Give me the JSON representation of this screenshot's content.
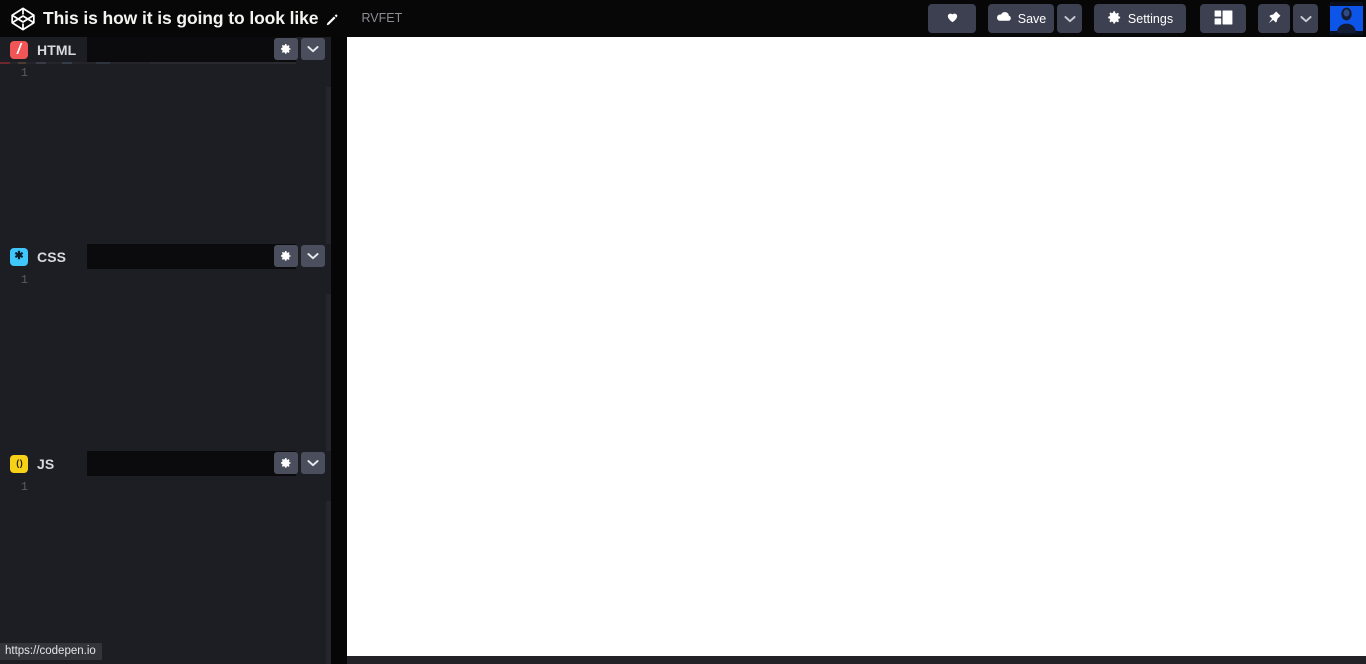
{
  "header": {
    "logo_icon": "codepen-logo-icon",
    "pen_title": "This is how it is going to look like",
    "title_edit_icon": "pencil-edit-icon",
    "author": "RVFET",
    "actions": {
      "heart_icon": "heart-icon",
      "heart_label": "",
      "save_icon": "cloud-icon",
      "save_label": "Save",
      "save_dropdown_icon": "chevron-down-icon",
      "settings_icon": "gear-icon",
      "settings_label": "Settings",
      "layout_icon": "layout-panels-icon",
      "pin_icon": "pin-icon",
      "pin_dropdown_icon": "chevron-down-icon",
      "avatar_alt": "user-avatar"
    }
  },
  "editors": [
    {
      "id": "html",
      "label": "HTML",
      "icon_glyph": "/",
      "icon_color": "#f25555",
      "icon_text_color": "#ffffff",
      "line_number": "1",
      "content": "",
      "settings_icon": "gear-icon",
      "collapse_icon": "chevron-down-icon"
    },
    {
      "id": "css",
      "label": "CSS",
      "icon_glyph": "✱",
      "icon_color": "#3fc7fb",
      "icon_text_color": "#0b1d28",
      "line_number": "1",
      "content": "",
      "settings_icon": "gear-icon",
      "collapse_icon": "chevron-down-icon"
    },
    {
      "id": "js",
      "label": "JS",
      "icon_glyph": "( )",
      "icon_color": "#f7d117",
      "icon_text_color": "#2a2200",
      "line_number": "1",
      "content": "",
      "settings_icon": "gear-icon",
      "collapse_icon": "chevron-down-icon"
    }
  ],
  "preview": {
    "content": ""
  },
  "status_bar": {
    "text": "https://codepen.io"
  },
  "colors": {
    "header_bg": "#070707",
    "editor_bg": "#1d1e24",
    "button_bg": "#3c4050",
    "panel_button_bg": "#4b4f5d",
    "preview_bg": "#ffffff",
    "status_bg": "#32343a",
    "label_text": "#d7d9de"
  }
}
